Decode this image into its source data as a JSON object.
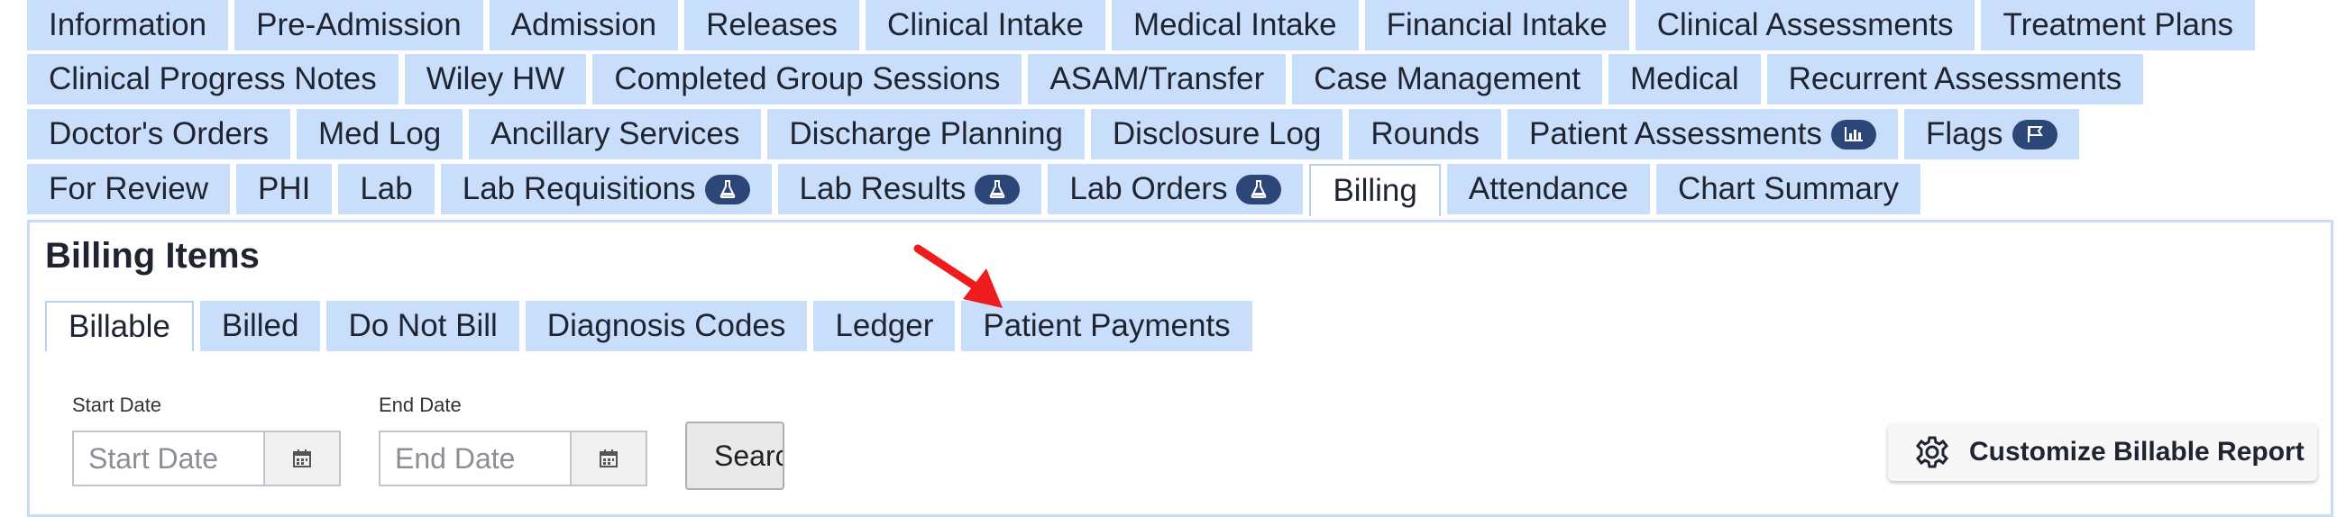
{
  "tabs": {
    "row1": [
      "Information",
      "Pre-Admission",
      "Admission",
      "Releases",
      "Clinical Intake",
      "Medical Intake",
      "Financial Intake",
      "Clinical Assessments",
      "Treatment Plans"
    ],
    "row2": [
      "Clinical Progress Notes",
      "Wiley HW",
      "Completed Group Sessions",
      "ASAM/Transfer",
      "Case Management",
      "Medical",
      "Recurrent Assessments"
    ],
    "row3": [
      {
        "label": "Doctor's Orders"
      },
      {
        "label": "Med Log"
      },
      {
        "label": "Ancillary Services"
      },
      {
        "label": "Discharge Planning"
      },
      {
        "label": "Disclosure Log"
      },
      {
        "label": "Rounds"
      },
      {
        "label": "Patient Assessments",
        "icon": "bar-chart-icon"
      },
      {
        "label": "Flags",
        "icon": "flag-icon"
      }
    ],
    "row4": [
      {
        "label": "For Review"
      },
      {
        "label": "PHI"
      },
      {
        "label": "Lab"
      },
      {
        "label": "Lab Requisitions",
        "icon": "flask-icon"
      },
      {
        "label": "Lab Results",
        "icon": "flask-icon"
      },
      {
        "label": "Lab Orders",
        "icon": "flask-icon"
      },
      {
        "label": "Billing",
        "active": true
      },
      {
        "label": "Attendance"
      },
      {
        "label": "Chart Summary"
      }
    ],
    "active": "Billing"
  },
  "billing": {
    "title": "Billing Items",
    "subtabs": [
      "Billable",
      "Billed",
      "Do Not Bill",
      "Diagnosis Codes",
      "Ledger",
      "Patient Payments"
    ],
    "active_subtab": "Billable",
    "start_date": {
      "label": "Start Date",
      "placeholder": "Start Date",
      "value": ""
    },
    "end_date": {
      "label": "End Date",
      "placeholder": "End Date",
      "value": ""
    },
    "search_label": "Search",
    "customize_label": "Customize Billable Report"
  },
  "colors": {
    "tab_bg": "#c9defa",
    "pill_bg": "#2c4777",
    "panel_border": "#c8dcf4",
    "arrow": "#ee1c1c"
  },
  "icons": {
    "calendar": "calendar-icon",
    "gear": "gear-icon",
    "annotation": "red-arrow"
  }
}
